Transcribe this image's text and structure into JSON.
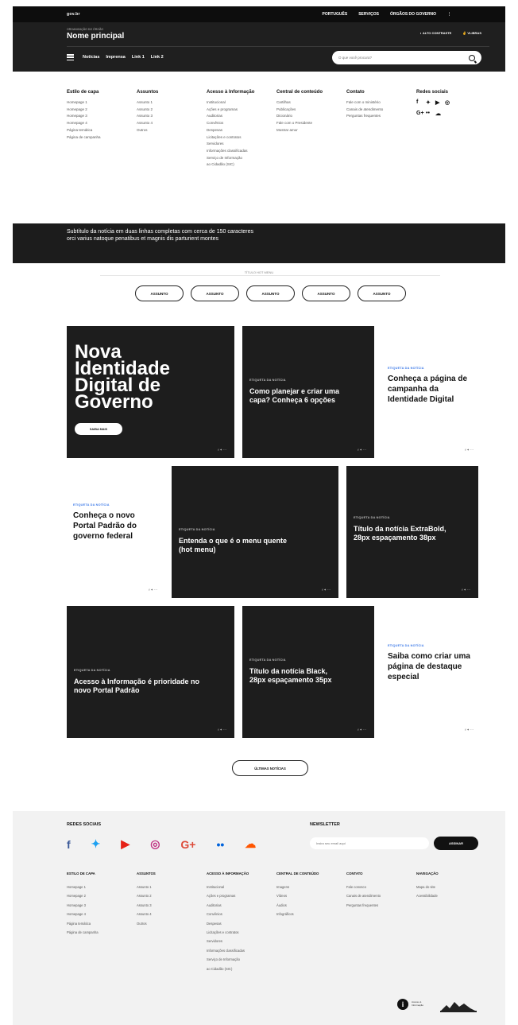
{
  "topbar": {
    "brand": "gov.br",
    "links": [
      "PORTUGUÊS",
      "SERVIÇOS",
      "ÓRGÃOS DO GOVERNO"
    ],
    "more": "⋮"
  },
  "header": {
    "org": "ORGANIZAÇÃO DO ÓRGÃO",
    "title": "Nome principal",
    "accessibility": "◐ ALTO CONTRASTE",
    "vlibras": "✌ VLIBRAS",
    "nav": [
      "Notícias",
      "Imprensa",
      "Link 1",
      "Link 2"
    ],
    "search_placeholder": "O que você procura?"
  },
  "mega": {
    "columns": [
      {
        "title": "Estilo de capa",
        "items": [
          "Homepage 1",
          "Homepage 2",
          "Homepage 3",
          "Homepage 4",
          "Página temática",
          "Página de campanha"
        ]
      },
      {
        "title": "Assuntos",
        "items": [
          "Assunto 1",
          "Assunto 2",
          "Assunto 3",
          "Assunto 4",
          "Outros"
        ]
      },
      {
        "title": "Acesso à Informação",
        "items": [
          "Institucional",
          "Ações e programas",
          "Auditorias",
          "Convênios",
          "Despesas",
          "Licitações e contratos",
          "Servidores",
          "Informações classificadas",
          "Serviço de Informação",
          "ao Cidadão (SIC)"
        ]
      },
      {
        "title": "Central de conteúdo",
        "items": [
          "Cartilhas",
          "Publicações",
          "Dicionário",
          "Fale com o Presidente",
          "Mostrar amor"
        ]
      },
      {
        "title": "Contato",
        "items": [
          "Fale com o ministério",
          "Canais de atendimento",
          "Perguntas frequentes"
        ]
      }
    ],
    "social_title": "Redes sociais",
    "social_glyphs": [
      "f",
      "✦",
      "▶",
      "◎",
      "G+",
      "••",
      "☁"
    ]
  },
  "band": {
    "line1": "Subtítulo da notícia em duas linhas completas com cerca de 150 caracteres",
    "line2": "orci varius natoque penatibus et magnis dis parturient montes"
  },
  "hotmenu": {
    "title": "TÍTULO HOT MENU",
    "chips": [
      "ASSUNTO",
      "ASSUNTO",
      "ASSUNTO",
      "ASSUNTO",
      "ASSUNTO"
    ]
  },
  "cards": {
    "hero": {
      "title": "Nova Identidade Digital de Governo",
      "button": "SAIBA MAIS",
      "share": "f ✦ ⋯"
    },
    "c1": {
      "tag": "ETIQUETA DA NOTÍCIA",
      "title": "Como planejar e criar uma capa? Conheça 6 opções",
      "share": "f ✦ ⋯"
    },
    "c2": {
      "tag": "ETIQUETA DA NOTÍCIA",
      "title": "Conheça a página de campanha da Identidade Digital",
      "share": "f ✦ ⋯"
    },
    "c3": {
      "tag": "ETIQUETA DA NOTÍCIA",
      "title": "Conheça o novo Portal Padrão do governo federal",
      "share": "f ✦ ⋯"
    },
    "c4": {
      "tag": "ETIQUETA DA NOTÍCIA",
      "title": "Entenda o que é o menu quente (hot menu)",
      "share": "f ✦ ⋯"
    },
    "c5": {
      "tag": "ETIQUETA DA NOTÍCIA",
      "title": "Título da notícia ExtraBold, 28px espaçamento 38px",
      "share": "f ✦ ⋯"
    },
    "c6": {
      "tag": "ETIQUETA DA NOTÍCIA",
      "title": "Acesso à Informação é prioridade no novo Portal Padrão",
      "share": "f ✦ ⋯"
    },
    "c7": {
      "tag": "ETIQUETA DA NOTÍCIA",
      "title": "Título da notícia Black, 28px espaçamento 35px",
      "share": "f ✦ ⋯"
    },
    "c8": {
      "tag": "ETIQUETA DA NOTÍCIA",
      "title": "Saiba como criar uma página de destaque especial",
      "share": "f ✦ ⋯"
    }
  },
  "more_button": "ÚLTIMAS NOTÍCIAS",
  "footer": {
    "social_title": "REDES SOCIAIS",
    "social_glyphs": [
      "f",
      "✦",
      "▶",
      "◎",
      "G+",
      "••",
      "☁"
    ],
    "social_colors": [
      "#3b5998",
      "#1da1f2",
      "#e62117",
      "#c13584",
      "#dd4b39",
      "#0063dc",
      "#ff5500"
    ],
    "newsletter_title": "NEWSLETTER",
    "newsletter_placeholder": "Insira seu email aqui",
    "newsletter_button": "ASSINAR",
    "columns": [
      {
        "title": "ESTILO DE CAPA",
        "items": [
          "Homepage 1",
          "Homepage 2",
          "Homepage 3",
          "Homepage 4",
          "Página temática",
          "Página de campanha"
        ]
      },
      {
        "title": "ASSUNTOS",
        "items": [
          "Assunto 1",
          "Assunto 2",
          "Assunto 3",
          "Assunto 4",
          "Outros"
        ]
      },
      {
        "title": "ACESSO À INFORMAÇÃO",
        "items": [
          "Institucional",
          "Ações e programas",
          "Auditorias",
          "Convênios",
          "Despesas",
          "Licitações e contratos",
          "Servidores",
          "Informações classificadas",
          "Serviço de Informação",
          "ao Cidadão (SIC)"
        ]
      },
      {
        "title": "CENTRAL DE CONTEÚDO",
        "items": [
          "Imagens",
          "Vídeos",
          "Áudios",
          "Infográficos"
        ]
      },
      {
        "title": "CONTATO",
        "items": [
          "Fale conosco",
          "Canais de atendimento",
          "Perguntas frequentes"
        ]
      },
      {
        "title": "NAVEGAÇÃO",
        "items": [
          "Mapa do site",
          "Acessibilidade"
        ]
      }
    ],
    "logo1_text": "Acesso à Informação"
  }
}
